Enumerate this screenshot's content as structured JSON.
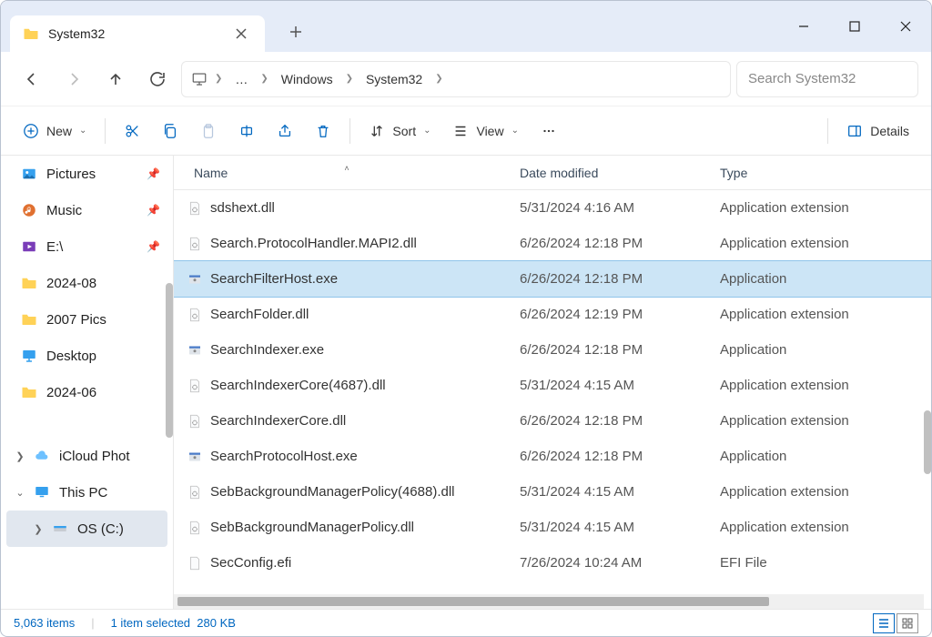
{
  "tab": {
    "title": "System32"
  },
  "breadcrumbs": {
    "seg1": "Windows",
    "seg2": "System32",
    "ellipsis": "…"
  },
  "search": {
    "placeholder": "Search System32"
  },
  "toolbar": {
    "new": "New",
    "sort": "Sort",
    "view": "View",
    "details": "Details"
  },
  "columns": {
    "name": "Name",
    "date": "Date modified",
    "type": "Type"
  },
  "sidebar": {
    "items": [
      {
        "label": "Pictures",
        "pinned": true,
        "icon": "pictures"
      },
      {
        "label": "Music",
        "pinned": true,
        "icon": "music"
      },
      {
        "label": "E:\\",
        "pinned": true,
        "icon": "video"
      },
      {
        "label": "2024-08",
        "icon": "folder"
      },
      {
        "label": "2007 Pics",
        "icon": "folder"
      },
      {
        "label": "Desktop",
        "icon": "desktop"
      },
      {
        "label": "2024-06",
        "icon": "folder"
      }
    ],
    "lower": [
      {
        "label": "iCloud Phot",
        "icon": "icloud",
        "expander": "right"
      },
      {
        "label": "This PC",
        "icon": "pc",
        "expander": "down"
      },
      {
        "label": "OS (C:)",
        "icon": "drive",
        "expander": "right",
        "indent": true,
        "selected": true
      }
    ]
  },
  "files": [
    {
      "name": "sdshext.dll",
      "date": "5/31/2024 4:16 AM",
      "type": "Application extension",
      "icon": "dll"
    },
    {
      "name": "Search.ProtocolHandler.MAPI2.dll",
      "date": "6/26/2024 12:18 PM",
      "type": "Application extension",
      "icon": "dll"
    },
    {
      "name": "SearchFilterHost.exe",
      "date": "6/26/2024 12:18 PM",
      "type": "Application",
      "icon": "exe",
      "selected": true
    },
    {
      "name": "SearchFolder.dll",
      "date": "6/26/2024 12:19 PM",
      "type": "Application extension",
      "icon": "dll"
    },
    {
      "name": "SearchIndexer.exe",
      "date": "6/26/2024 12:18 PM",
      "type": "Application",
      "icon": "exe"
    },
    {
      "name": "SearchIndexerCore(4687).dll",
      "date": "5/31/2024 4:15 AM",
      "type": "Application extension",
      "icon": "dll"
    },
    {
      "name": "SearchIndexerCore.dll",
      "date": "6/26/2024 12:18 PM",
      "type": "Application extension",
      "icon": "dll"
    },
    {
      "name": "SearchProtocolHost.exe",
      "date": "6/26/2024 12:18 PM",
      "type": "Application",
      "icon": "exe"
    },
    {
      "name": "SebBackgroundManagerPolicy(4688).dll",
      "date": "5/31/2024 4:15 AM",
      "type": "Application extension",
      "icon": "dll"
    },
    {
      "name": "SebBackgroundManagerPolicy.dll",
      "date": "5/31/2024 4:15 AM",
      "type": "Application extension",
      "icon": "dll"
    },
    {
      "name": "SecConfig.efi",
      "date": "7/26/2024 10:24 AM",
      "type": "EFI File",
      "icon": "file"
    }
  ],
  "status": {
    "count": "5,063 items",
    "selection": "1 item selected",
    "size": "280 KB"
  }
}
